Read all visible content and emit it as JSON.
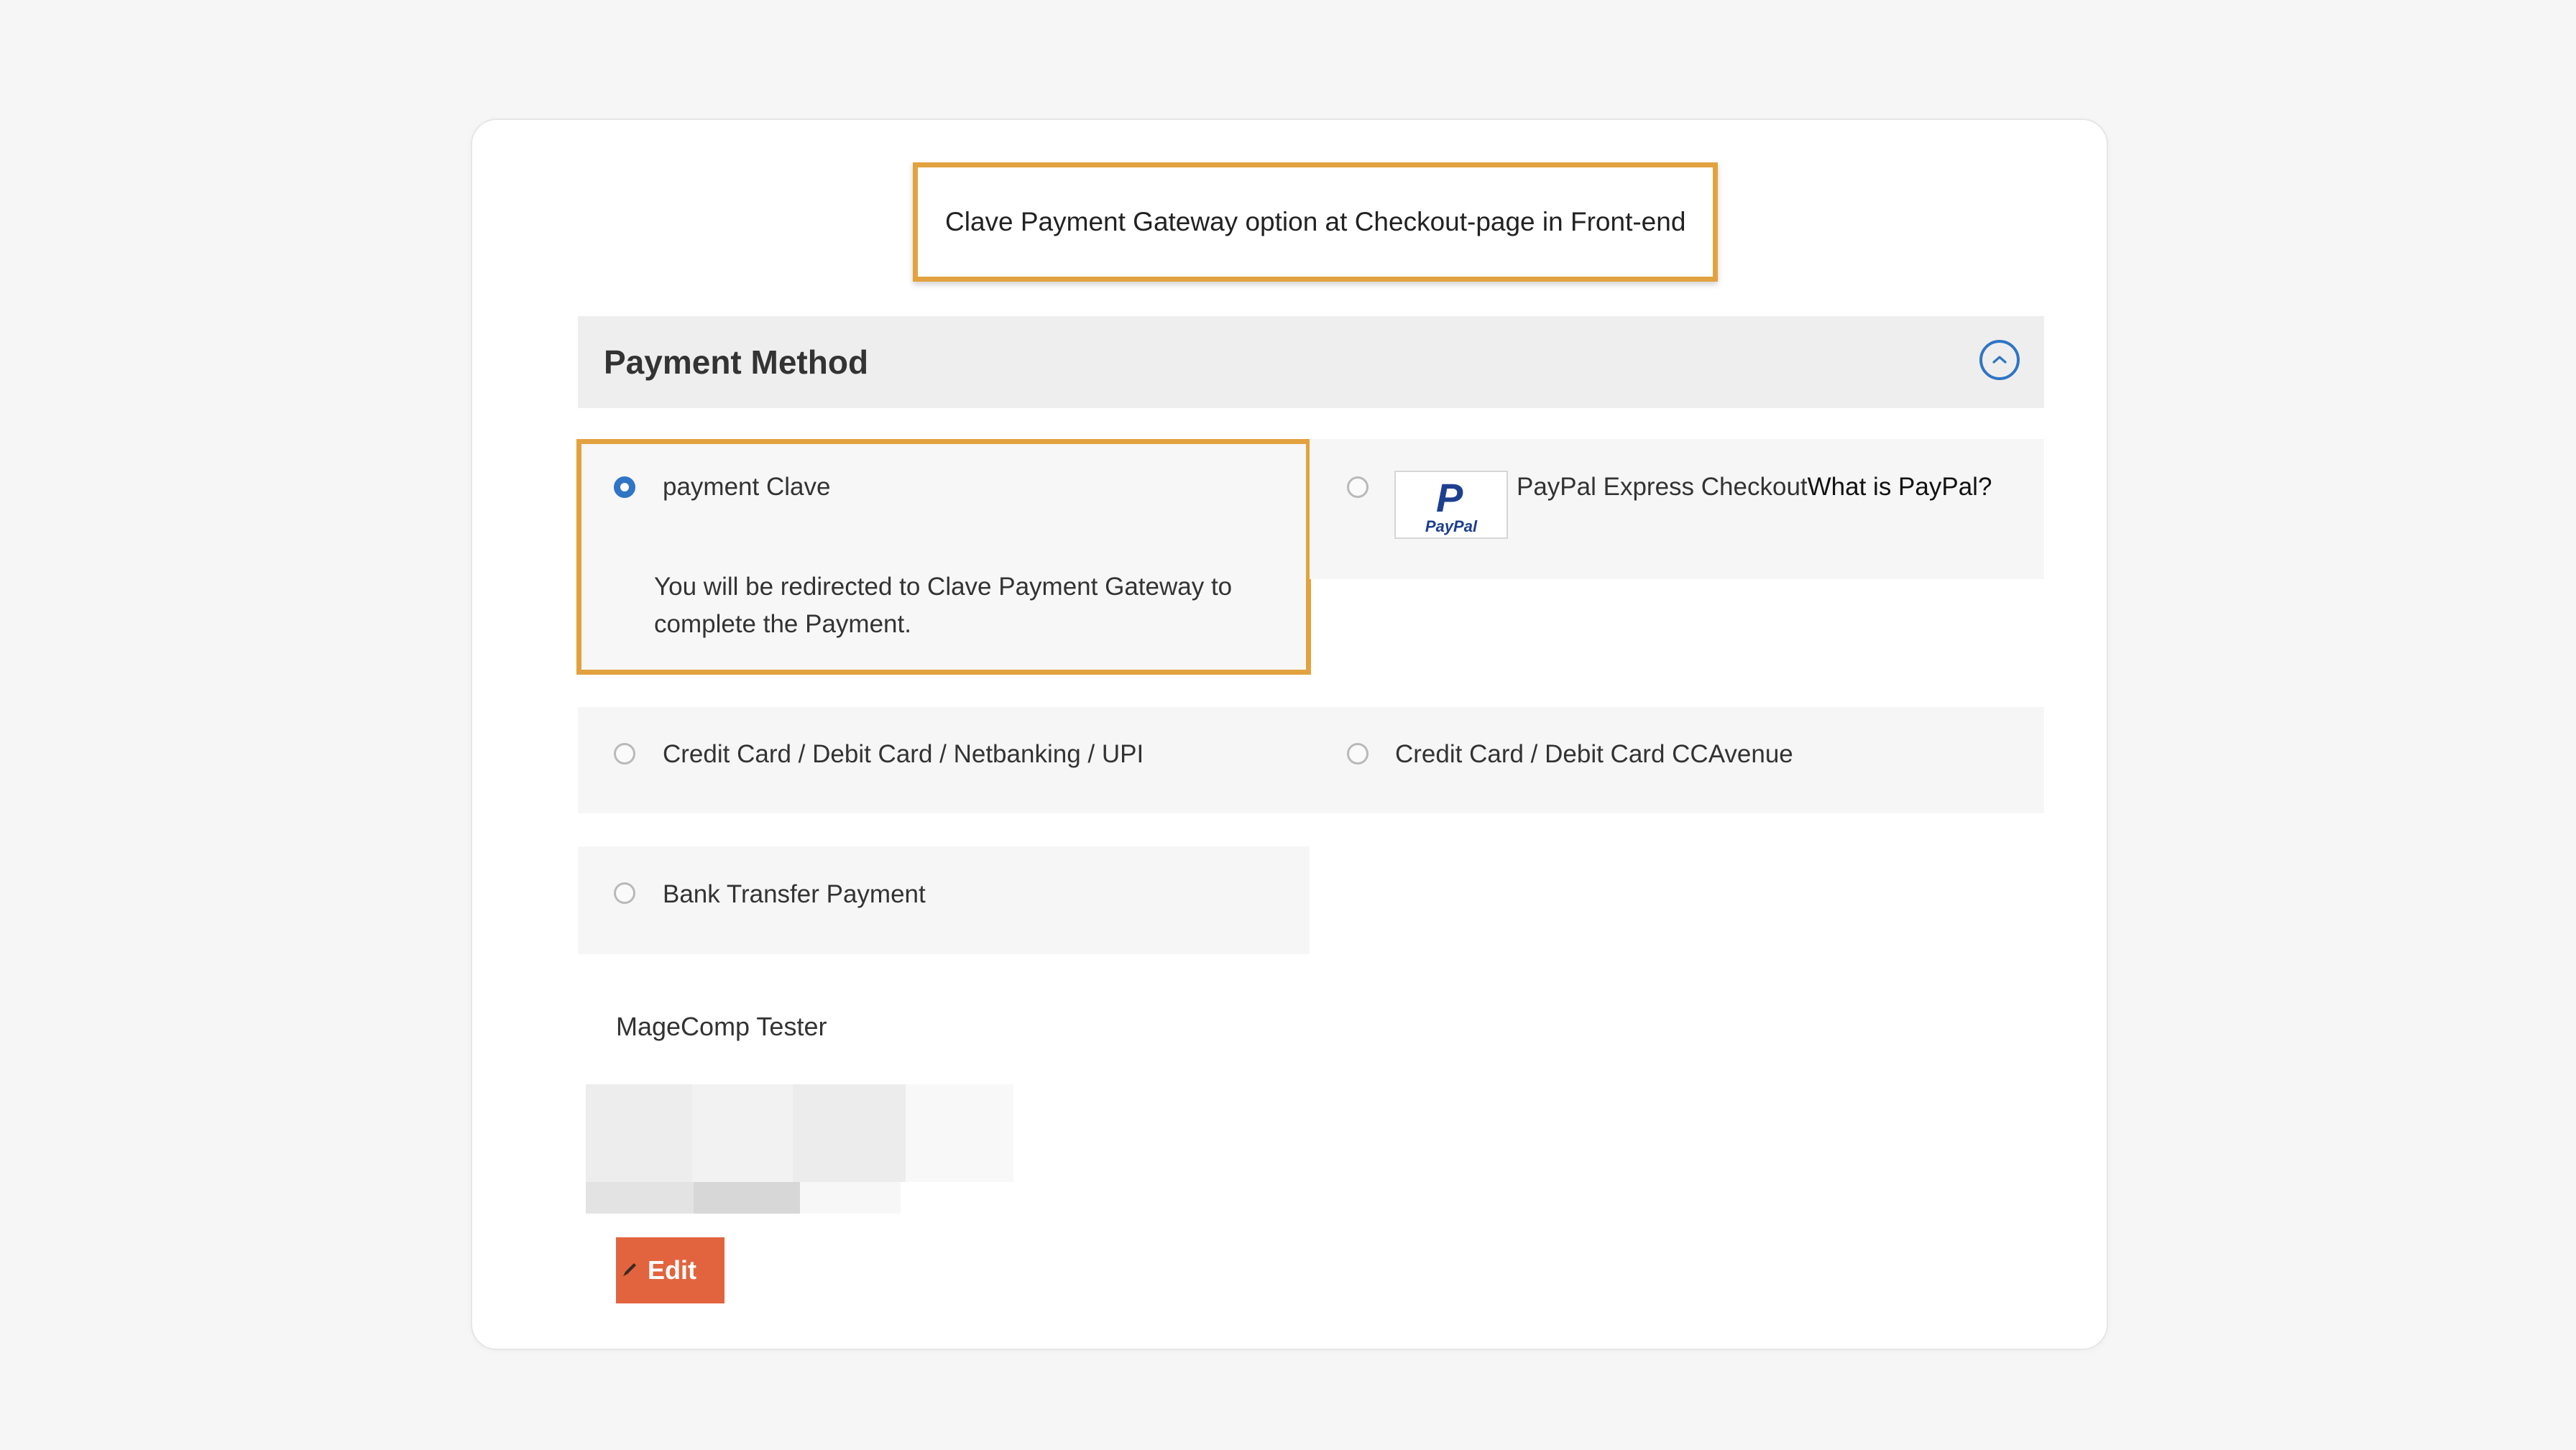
{
  "callout": {
    "text": "Clave Payment Gateway option at Checkout-page in Front-end"
  },
  "payment_method": {
    "title": "Payment Method",
    "collapse_icon": "chevron-up-circle-icon"
  },
  "options": {
    "clave": {
      "label": "payment Clave",
      "description": "You will be redirected to Clave Payment Gateway to complete the Payment.",
      "selected": true
    },
    "paypal": {
      "label": "PayPal Express Checkout",
      "link": "What is PayPal?",
      "logo_text": "PayPal",
      "selected": false
    },
    "card_upi": {
      "label": "Credit Card / Debit Card / Netbanking / UPI",
      "selected": false
    },
    "ccavenue": {
      "label": "Credit Card / Debit Card CCAvenue",
      "selected": false
    },
    "bank_transfer": {
      "label": "Bank Transfer Payment",
      "selected": false
    }
  },
  "billing": {
    "name": "MageComp Tester",
    "edit_label": "Edit"
  },
  "colors": {
    "accent_orange": "#e2a23f",
    "radio_blue": "#2f75c4",
    "edit_button": "#e2643e",
    "paypal_blue": "#1d3f8f"
  }
}
